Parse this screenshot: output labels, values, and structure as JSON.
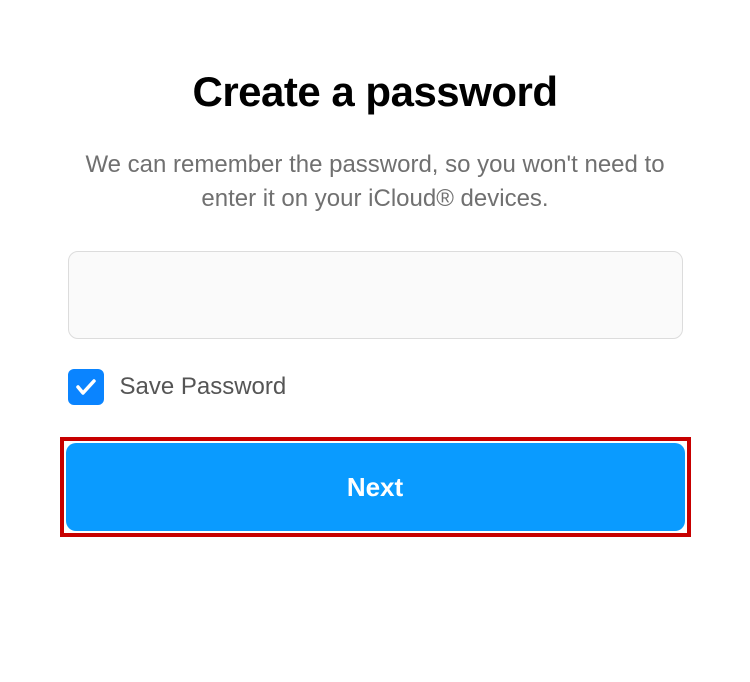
{
  "title": "Create a password",
  "subtitle": "We can remember the password, so you won't need to enter it on your iCloud® devices.",
  "password_value": "",
  "save_password_label": "Save Password",
  "save_password_checked": true,
  "next_button_label": "Next",
  "colors": {
    "accent": "#0a9bff",
    "checkbox": "#0a84ff",
    "highlight_border": "#c70000"
  }
}
